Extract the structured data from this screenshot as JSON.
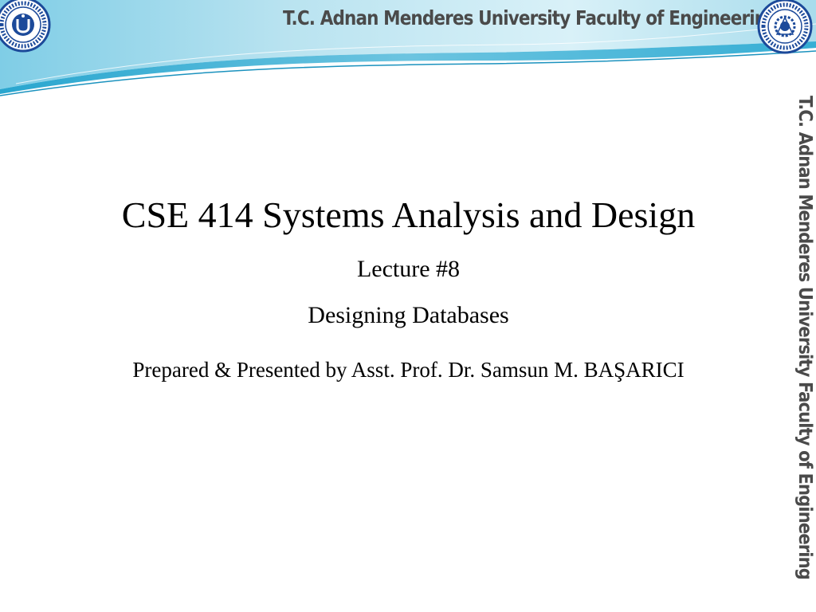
{
  "header": {
    "banner_text": "T.C.   Adnan Menderes University   Faculty of Engineering",
    "side_text": "T.C.   Adnan Menderes University   Faculty of Engineering",
    "left_logo": {
      "icon": "university-seal-icon",
      "lettering": "ADNAN MENDERES ÜNİVERSİTESİ 1992"
    },
    "right_logo": {
      "icon": "faculty-seal-icon",
      "lettering": "ADNAN MENDERES UNIVERSITY ENGINEERING FACULTY 2005"
    }
  },
  "slide": {
    "title": "CSE 414 Systems Analysis and Design",
    "lecture": "Lecture #8",
    "topic": "Designing Databases",
    "presenter": "Prepared & Presented by Asst. Prof. Dr. Samsun M. BAŞARICI"
  },
  "colors": {
    "band_light": "#cfeaf3",
    "band_mid": "#7fc8e0",
    "band_dark": "#2aa7cf",
    "header_text": "#4a4a4a",
    "seal_blue": "#1c4a9a"
  }
}
